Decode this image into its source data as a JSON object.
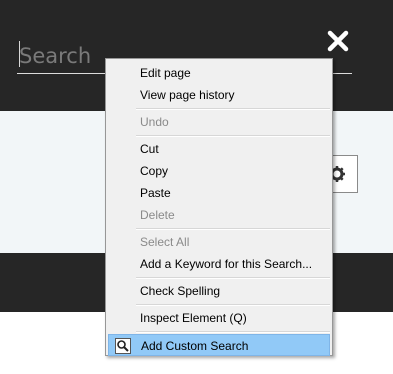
{
  "search": {
    "placeholder": "Search"
  },
  "icons": {
    "close": "close-icon",
    "settings": "gear-icon",
    "custom_search": "magnifier-icon"
  },
  "context_menu": {
    "edit_page": "Edit page",
    "view_history": "View page history",
    "undo": "Undo",
    "cut": "Cut",
    "copy": "Copy",
    "paste": "Paste",
    "delete": "Delete",
    "select_all": "Select All",
    "add_keyword": "Add a Keyword for this Search...",
    "check_spelling": "Check Spelling",
    "inspect_element": "Inspect Element (Q)",
    "add_custom_search": "Add Custom Search"
  },
  "colors": {
    "header_bg": "#262626",
    "band_bg": "#f2f6f8",
    "menu_bg": "#f0f0f0",
    "highlight": "#91c9f7"
  }
}
